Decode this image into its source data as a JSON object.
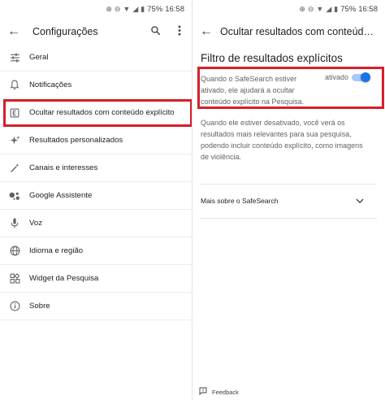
{
  "status_bar": {
    "battery": "75%",
    "time": "16:58"
  },
  "left": {
    "title": "Configurações",
    "menu": [
      {
        "label": "Geral",
        "icon": "sliders-icon"
      },
      {
        "label": "Notificações",
        "icon": "bell-icon"
      },
      {
        "label": "Ocultar resultados com conteúdo explícito",
        "icon": "explicit-icon"
      },
      {
        "label": "Resultados personalizados",
        "icon": "sparkle-icon"
      },
      {
        "label": "Canais e interesses",
        "icon": "magic-wand-icon"
      },
      {
        "label": "Google Assistente",
        "icon": "assistant-icon"
      },
      {
        "label": "Voz",
        "icon": "mic-icon"
      },
      {
        "label": "Idioma e região",
        "icon": "globe-icon"
      },
      {
        "label": "Widget da Pesquisa",
        "icon": "widgets-icon"
      },
      {
        "label": "Sobre",
        "icon": "info-icon"
      }
    ]
  },
  "right": {
    "title": "Ocultar resultados com conteúdo explícito",
    "section_title": "Filtro de resultados explícitos",
    "desc_on": "Quando o SafeSearch estiver ativado, ele ajudará a ocultar conteúdo explícito na Pesquisa.",
    "toggle_label": "ativado",
    "toggle_on": true,
    "desc_off": "Quando ele estiver desativado, você verá os resultados mais relevantes para sua pesquisa, podendo incluir conteúdo explícito, como imagens de violência.",
    "more_label": "Mais sobre o SafeSearch",
    "feedback_label": "Feedback"
  },
  "colors": {
    "highlight": "#d5202b",
    "accent": "#1a73e8"
  }
}
